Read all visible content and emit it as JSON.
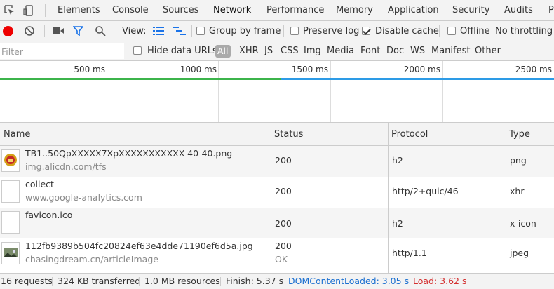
{
  "tabs": [
    "Elements",
    "Console",
    "Sources",
    "Network",
    "Performance",
    "Memory",
    "Application",
    "Security",
    "Audits",
    "Pa"
  ],
  "active_tab": "Network",
  "toolbar": {
    "view_label": "View:",
    "group_by_frame": "Group by frame",
    "preserve_log": "Preserve log",
    "disable_cache": "Disable cache",
    "offline": "Offline",
    "throttling": "No throttling",
    "group_by_frame_checked": false,
    "preserve_log_checked": false,
    "disable_cache_checked": true,
    "offline_checked": false
  },
  "filter": {
    "placeholder": "Filter",
    "hide_data_urls": "Hide data URLs",
    "types": [
      "All",
      "XHR",
      "JS",
      "CSS",
      "Img",
      "Media",
      "Font",
      "Doc",
      "WS",
      "Manifest",
      "Other"
    ]
  },
  "timeline": {
    "ticks": [
      "500 ms",
      "1000 ms",
      "1500 ms",
      "2000 ms",
      "2500 ms"
    ],
    "colors": {
      "green": "#3cb44b",
      "blue": "#2d9be6",
      "red": "#e23b3b"
    }
  },
  "table": {
    "headers": [
      "Name",
      "Status",
      "Protocol",
      "Type"
    ],
    "rows": [
      {
        "name": "TB1..50QpXXXXX7XpXXXXXXXXXXX-40-40.png",
        "host": "img.alicdn.com/tfs",
        "status": "200",
        "status_text": "",
        "protocol": "h2",
        "type": "png",
        "icon": "emblem-image-icon"
      },
      {
        "name": "collect",
        "host": "www.google-analytics.com",
        "status": "200",
        "status_text": "",
        "protocol": "http/2+quic/46",
        "type": "xhr",
        "icon": "blank-file-icon"
      },
      {
        "name": "favicon.ico",
        "host": "",
        "status": "200",
        "status_text": "",
        "protocol": "h2",
        "type": "x-icon",
        "icon": "blank-file-icon"
      },
      {
        "name": "112fb9389b504fc20824ef63e4dde71190ef6d5a.jpg",
        "host": "chasingdream.cn/articleImage",
        "status": "200",
        "status_text": "OK",
        "protocol": "http/1.1",
        "type": "jpeg",
        "icon": "photo-image-icon"
      }
    ]
  },
  "status_bar": {
    "requests": "16 requests",
    "transferred": "324 KB transferred",
    "resources": "1.0 MB resources",
    "finish": "Finish: 5.37 s",
    "dom_content_loaded": "DOMContentLoaded: 3.05 s",
    "load": "Load: 3.62 s"
  }
}
